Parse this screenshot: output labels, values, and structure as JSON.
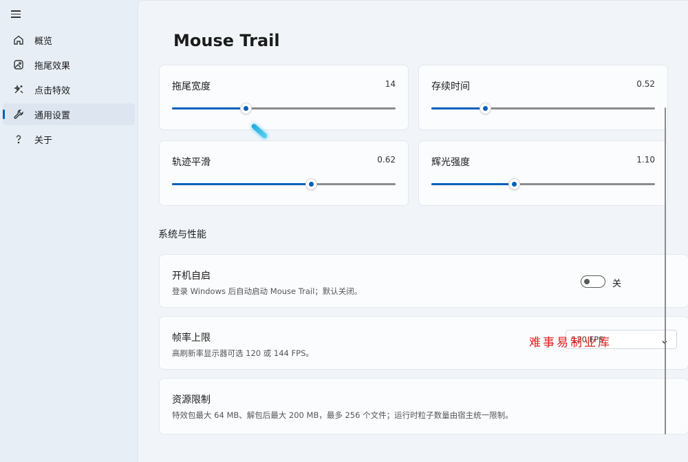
{
  "sidebar": {
    "items": [
      {
        "label": "概览",
        "icon": "home-icon",
        "active": false
      },
      {
        "label": "拖尾效果",
        "icon": "image-icon",
        "active": false
      },
      {
        "label": "点击特效",
        "icon": "sparkle-icon",
        "active": false
      },
      {
        "label": "通用设置",
        "icon": "wrench-icon",
        "active": true
      },
      {
        "label": "关于",
        "icon": "question-icon",
        "active": false
      }
    ]
  },
  "page": {
    "title": "Mouse Trail"
  },
  "sliders": [
    {
      "label": "拖尾宽度",
      "value": "14",
      "fraction": 0.33
    },
    {
      "label": "存续时间",
      "value": "0.52",
      "fraction": 0.24
    },
    {
      "label": "轨迹平滑",
      "value": "0.62",
      "fraction": 0.62
    },
    {
      "label": "辉光强度",
      "value": "1.10",
      "fraction": 0.37
    }
  ],
  "section": {
    "title": "系统与性能"
  },
  "settings": {
    "autostart": {
      "title": "开机自启",
      "desc": "登录 Windows 后自动启动 Mouse Trail；默认关闭。",
      "toggle_text": "关",
      "on": false
    },
    "framerate": {
      "title": "帧率上限",
      "desc": "高刷新率显示器可选 120 或 144 FPS。",
      "selected": "120 FPS"
    },
    "resources": {
      "title": "资源限制",
      "desc": "特效包最大 64 MB、解包后最大 200 MB，最多 256 个文件；运行时粒子数量由宿主统一限制。"
    }
  },
  "watermark": "难事易制业库",
  "colors": {
    "accent": "#005fb8",
    "track": "#8a8a8a",
    "watermark": "#e0221d"
  }
}
